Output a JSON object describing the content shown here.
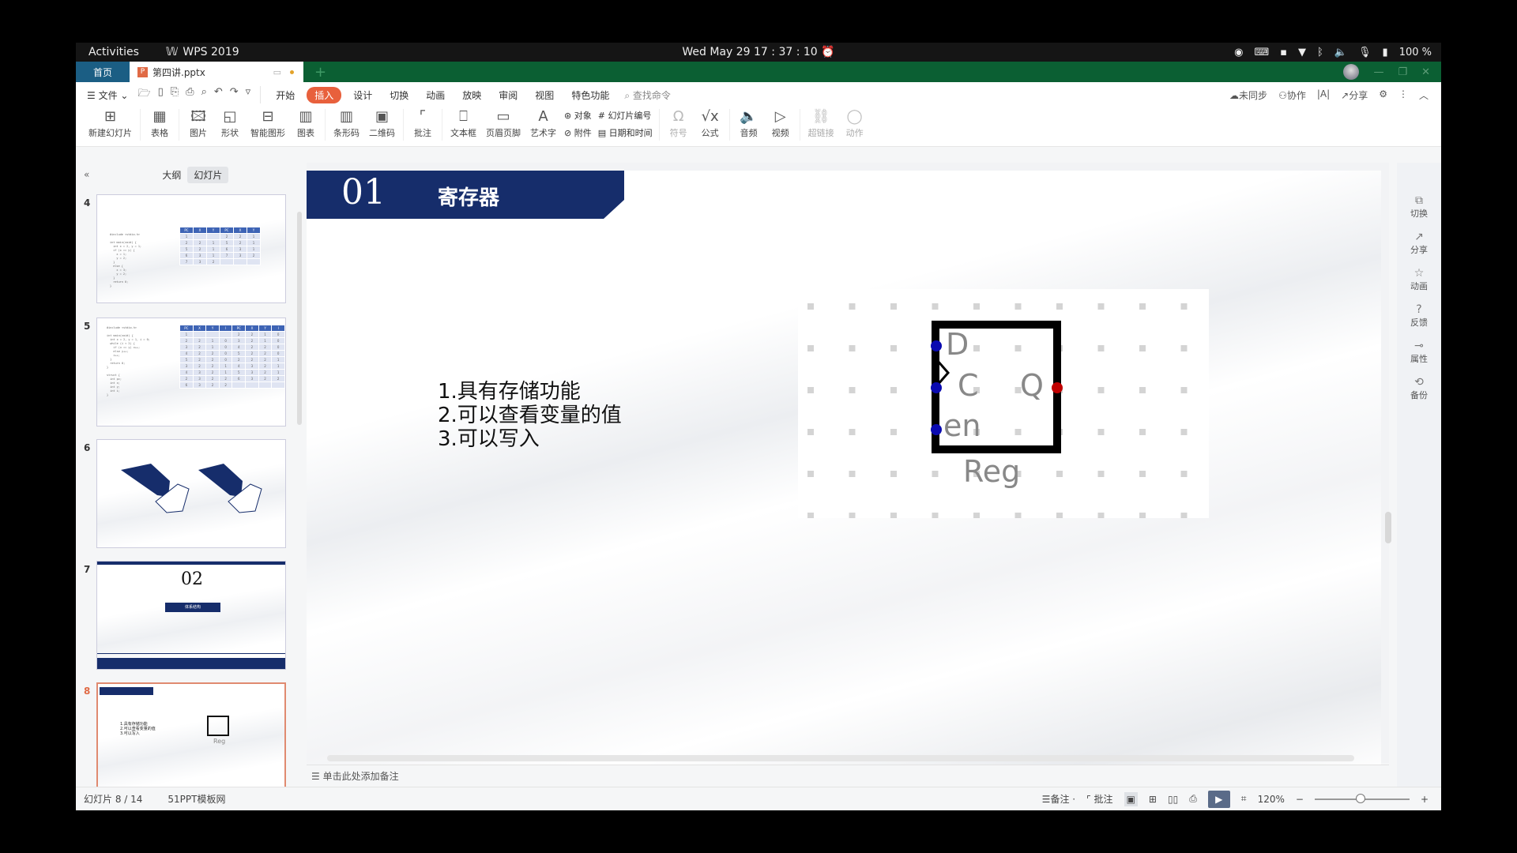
{
  "os": {
    "activities": "Activities",
    "app_name": "WPS 2019",
    "clock": "Wed May 29  17 : 37 : 10",
    "battery": "100 %"
  },
  "tabs": {
    "home": "首页",
    "doc": "第四讲.pptx"
  },
  "menu": {
    "file": "文件",
    "items": [
      "开始",
      "插入",
      "设计",
      "切换",
      "动画",
      "放映",
      "审阅",
      "视图",
      "特色功能"
    ],
    "active": "插入",
    "search": "查找命令",
    "right": [
      "未同步",
      "协作",
      "分享"
    ]
  },
  "ribbon": {
    "buttons": [
      {
        "label": "新建幻灯片",
        "icon": "new-slide"
      },
      {
        "label": "表格",
        "icon": "table"
      },
      {
        "label": "图片",
        "icon": "picture"
      },
      {
        "label": "形状",
        "icon": "shape"
      },
      {
        "label": "智能图形",
        "icon": "smartart"
      },
      {
        "label": "图表",
        "icon": "chart"
      },
      {
        "label": "条形码",
        "icon": "barcode"
      },
      {
        "label": "二维码",
        "icon": "qrcode"
      },
      {
        "label": "批注",
        "icon": "comment"
      },
      {
        "label": "文本框",
        "icon": "textbox"
      },
      {
        "label": "页眉页脚",
        "icon": "header-footer"
      },
      {
        "label": "艺术字",
        "icon": "wordart"
      }
    ],
    "small": [
      "对象",
      "附件",
      "幻灯片编号",
      "日期和时间"
    ],
    "buttons2": [
      {
        "label": "符号",
        "icon": "omega",
        "disabled": true
      },
      {
        "label": "公式",
        "icon": "formula",
        "disabled": false
      },
      {
        "label": "音频",
        "icon": "audio",
        "disabled": false
      },
      {
        "label": "视频",
        "icon": "video",
        "disabled": false
      },
      {
        "label": "超链接",
        "icon": "link",
        "disabled": true
      },
      {
        "label": "动作",
        "icon": "mouse",
        "disabled": true
      }
    ]
  },
  "panel": {
    "tab_outline": "大纲",
    "tab_slides": "幻灯片",
    "slides": [
      {
        "num": "4"
      },
      {
        "num": "5"
      },
      {
        "num": "6"
      },
      {
        "num": "7",
        "title": "02",
        "subtitle": "体系结构"
      },
      {
        "num": "8",
        "selected": true
      }
    ]
  },
  "slide": {
    "number": "01",
    "title": "寄存器",
    "list": [
      "1.具有存储功能",
      "2.可以查看变量的值",
      "3.可以写入"
    ],
    "diagram": {
      "pins_left": [
        "D",
        "C",
        "en"
      ],
      "pin_right": "Q",
      "label": "Reg",
      "input_color": "#0a0ab0",
      "output_color": "#c00000"
    }
  },
  "notes_placeholder": "单击此处添加备注",
  "right_panel": [
    "切换",
    "分享",
    "动画",
    "反馈",
    "属性",
    "备份"
  ],
  "status": {
    "slide_info": "幻灯片 8 / 14",
    "template": "51PPT模板网",
    "notes": "备注",
    "comments": "批注",
    "zoom": "120%",
    "zoom_fraction": 0.48
  },
  "colors": {
    "tab_green": "#0b5f33",
    "accent": "#e8603c",
    "banner": "#162d6b"
  }
}
